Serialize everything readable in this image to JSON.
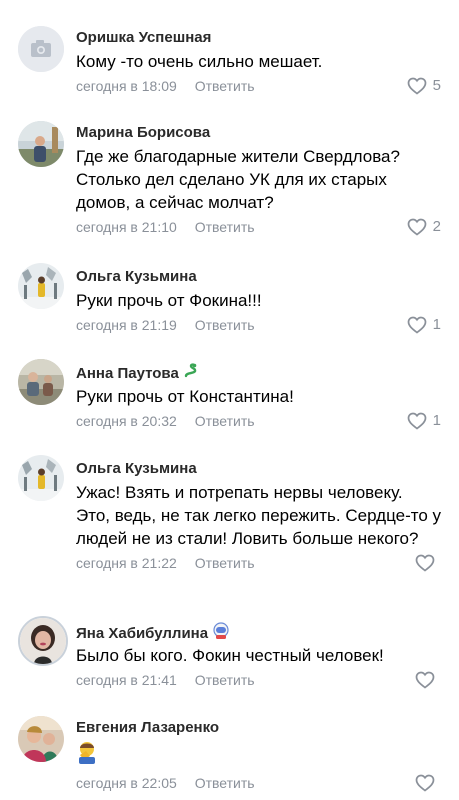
{
  "comments": [
    {
      "author": "Оришка Успешная",
      "text": "Кому -то очень сильно мешает.",
      "time": "сегодня в 18:09",
      "reply": "Ответить",
      "likes": "5",
      "avatar": "camera-placeholder"
    },
    {
      "author": "Марина Борисова",
      "text": "Где же благодарные жители Свердлова? Столько дел сделано УК для их старых домов, а сейчас молчат?",
      "time": "сегодня в 21:10",
      "reply": "Ответить",
      "likes": "2",
      "avatar": "photo"
    },
    {
      "author": "Ольга Кузьмина",
      "text": "Руки прочь от Фокина!!!",
      "time": "сегодня в 21:19",
      "reply": "Ответить",
      "likes": "1",
      "avatar": "photo"
    },
    {
      "author": "Анна Паутова",
      "text": "Руки прочь от Константина!",
      "time": "сегодня в 20:32",
      "reply": "Ответить",
      "likes": "1",
      "avatar": "photo",
      "badge": "snake-icon"
    },
    {
      "author": "Ольга Кузьмина",
      "text": "Ужас! Взять и потрепать  нервы человеку. Это, ведь, не так легко пережить. Сердце-то у людей не из стали! Ловить больше некого?",
      "time": "сегодня в 21:22",
      "reply": "Ответить",
      "likes": "",
      "avatar": "photo"
    },
    {
      "author": "Яна Хабибуллина",
      "text": "Было бы кого. Фокин честный человек!",
      "time": "сегодня в 21:41",
      "reply": "Ответить",
      "likes": "",
      "avatar": "photo",
      "badge": "astronaut-icon"
    },
    {
      "author": "Евгения Лазаренко",
      "text": "🤦",
      "time": "сегодня в 22:05",
      "reply": "Ответить",
      "likes": "",
      "avatar": "photo"
    }
  ],
  "colors": {
    "meta": "#8a9099",
    "name": "#2a2a2a",
    "text": "#000000",
    "background": "#ffffff"
  }
}
